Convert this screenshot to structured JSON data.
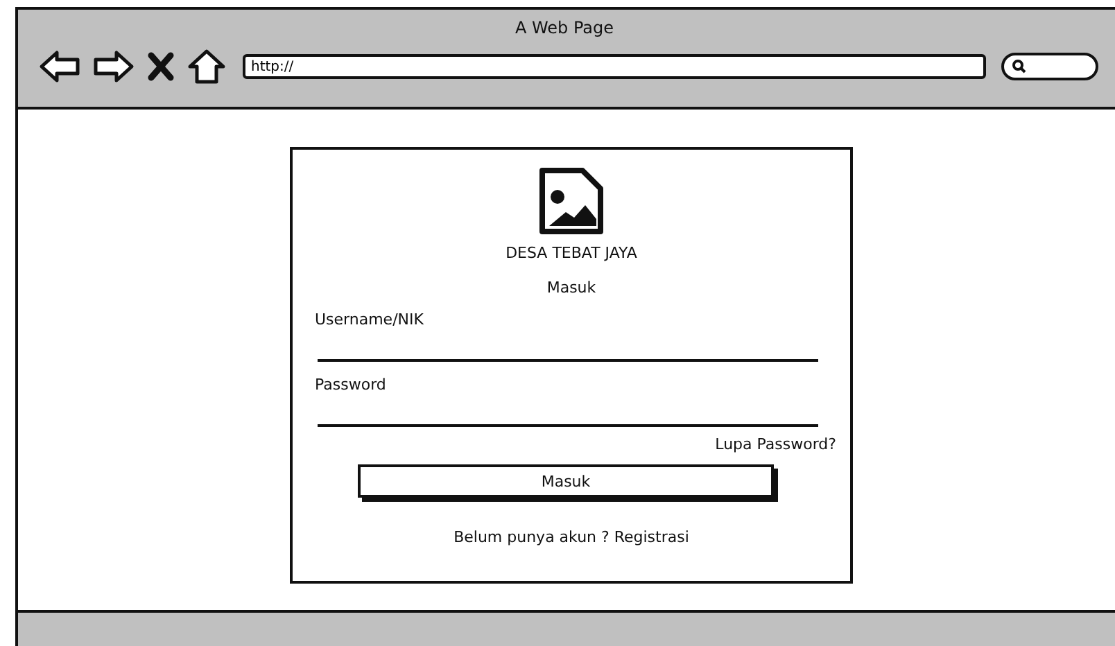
{
  "window": {
    "title": "A Web Page"
  },
  "address_bar": {
    "value": "http://"
  },
  "login": {
    "title": "DESA TEBAT JAYA",
    "heading": "Masuk",
    "fields": [
      {
        "label": "Username/NIK"
      },
      {
        "label": "Password"
      }
    ],
    "forgot_link": "Lupa Password?",
    "button": "Masuk",
    "register_text": "Belum punya akun ? Registrasi"
  }
}
